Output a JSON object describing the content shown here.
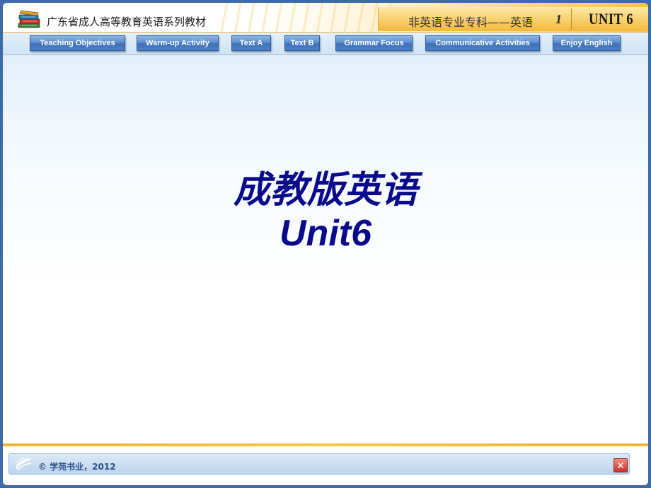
{
  "header": {
    "series_title": "广东省成人高等教育英语系列教材",
    "course_title": "非英语专业专科——英语",
    "course_number": "1",
    "unit_label": "UNIT 6",
    "logo_icon": "books-icon"
  },
  "nav": {
    "items": [
      {
        "label": "Teaching Objectives"
      },
      {
        "label": "Warm-up Activity"
      },
      {
        "label": "Text A"
      },
      {
        "label": "Text B"
      },
      {
        "label": "Grammar Focus"
      },
      {
        "label": "Communicative Activities"
      },
      {
        "label": "Enjoy English"
      }
    ]
  },
  "main": {
    "title": "成教版英语",
    "subtitle": "Unit6"
  },
  "footer": {
    "copyright": "© 学苑书业，2012",
    "close_symbol": "✕",
    "swirl_icon": "swirl-logo-icon",
    "close_icon": "close-icon"
  },
  "colors": {
    "title_blue": "#0a0a8c",
    "nav_blue": "#4d82c8",
    "accent_orange": "#f2b338",
    "close_red": "#c8342a"
  }
}
